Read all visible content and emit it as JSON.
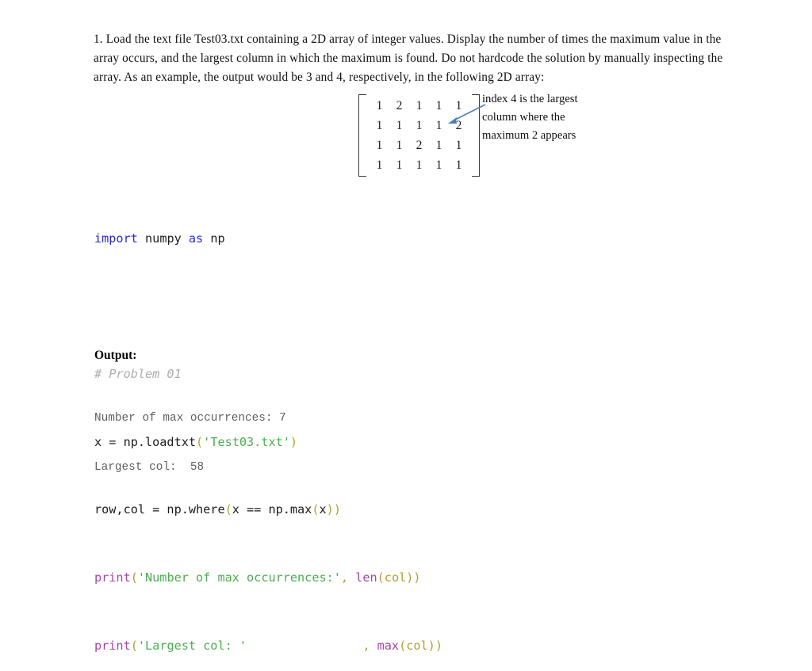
{
  "document": {
    "problem_statement": "1. Load the text file Test03.txt containing a 2D array of integer values. Display the number of times the maximum value in the array occurs, and the largest column in which the maximum is found. Do not hardcode the solution by manually inspecting the array. As an example, the output would be 3 and 4, respectively, in the following 2D array:"
  },
  "matrix": {
    "rows": 4,
    "cols": 5,
    "values": [
      [
        "1",
        "2",
        "1",
        "1",
        "1"
      ],
      [
        "1",
        "1",
        "1",
        "1",
        "2"
      ],
      [
        "1",
        "1",
        "2",
        "1",
        "1"
      ],
      [
        "1",
        "1",
        "1",
        "1",
        "1"
      ]
    ]
  },
  "annotation": {
    "line1": "index 4 is the largest",
    "line2": "column where the",
    "line3": "maximum 2 appears",
    "arrow_color": "#4a7ebb"
  },
  "code": {
    "line1": {
      "kw_import": "import",
      "space1": " ",
      "mod": "numpy",
      "space2": " ",
      "kw_as": "as",
      "space3": " ",
      "alias": "np"
    },
    "line2_comment": "# Problem 01",
    "line3": {
      "lhs": "x = np.loadtxt",
      "open": "(",
      "string": "'Test03.txt'",
      "close": ")"
    },
    "line4": {
      "lhs": "row,col = np.where",
      "open": "(",
      "inner": "x == np.max",
      "open2": "(",
      "var": "x",
      "close2": ")",
      "close": ")"
    },
    "line5": {
      "func": "print",
      "open": "(",
      "string": "'Number of max occurrences:'",
      "comma": ", ",
      "func2": "len",
      "open2": "(",
      "var": "col",
      "close2": ")",
      "close": ")"
    },
    "line6": {
      "func": "print",
      "open": "(",
      "string": "'Largest col: '",
      "gap": "                ",
      "comma": ", ",
      "func2": "max",
      "open2": "(",
      "var": "col",
      "close2": ")",
      "close": ")"
    }
  },
  "output": {
    "heading": "Output:",
    "line1": "Number of max occurrences: 7",
    "line2": "Largest col:  58"
  }
}
